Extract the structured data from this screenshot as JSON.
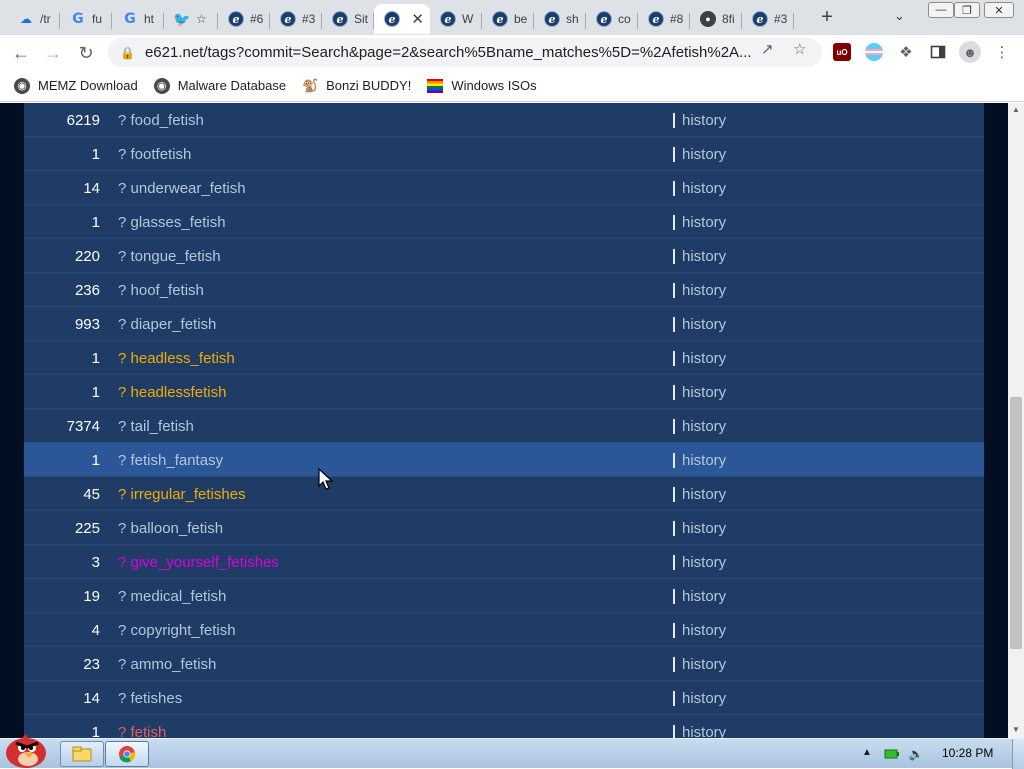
{
  "browser": {
    "tabs": [
      {
        "title": "/tr",
        "icon": "cloud-icon"
      },
      {
        "title": "fu",
        "icon": "google-icon"
      },
      {
        "title": "ht",
        "icon": "google-icon"
      },
      {
        "title": "☆",
        "icon": "twitter-icon"
      },
      {
        "title": "#6",
        "icon": "e621-icon"
      },
      {
        "title": "#3",
        "icon": "e621-icon"
      },
      {
        "title": "Sit",
        "icon": "e621-icon"
      },
      {
        "title": "",
        "icon": "e621-icon",
        "active": true
      },
      {
        "title": "W",
        "icon": "e621-icon"
      },
      {
        "title": "be",
        "icon": "e621-icon"
      },
      {
        "title": "sh",
        "icon": "e621-icon"
      },
      {
        "title": "co",
        "icon": "e621-icon"
      },
      {
        "title": "#8",
        "icon": "e621-icon"
      },
      {
        "title": "8fi",
        "icon": "github-icon"
      },
      {
        "title": "#3",
        "icon": "e621-icon"
      }
    ],
    "new_tab_glyph": "+",
    "url": "e621.net/tags?commit=Search&page=2&search%5Bname_matches%5D=%2Afetish%2A..."
  },
  "bookmarks": [
    {
      "label": "MEMZ Download",
      "icon": "globe-icon"
    },
    {
      "label": "Malware Database",
      "icon": "globe-icon"
    },
    {
      "label": "Bonzi BUDDY!",
      "icon": "bonzi-icon"
    },
    {
      "label": "Windows ISOs",
      "icon": "rainbow-flag-icon"
    }
  ],
  "tag_rows": [
    {
      "count": "6219",
      "name": "? food_fetish",
      "color": "#b4c7d9",
      "history": "history"
    },
    {
      "count": "1",
      "name": "? footfetish",
      "color": "#b4c7d9",
      "history": "history"
    },
    {
      "count": "14",
      "name": "? underwear_fetish",
      "color": "#b4c7d9",
      "history": "history"
    },
    {
      "count": "1",
      "name": "? glasses_fetish",
      "color": "#b4c7d9",
      "history": "history"
    },
    {
      "count": "220",
      "name": "? tongue_fetish",
      "color": "#b4c7d9",
      "history": "history"
    },
    {
      "count": "236",
      "name": "? hoof_fetish",
      "color": "#b4c7d9",
      "history": "history"
    },
    {
      "count": "993",
      "name": "? diaper_fetish",
      "color": "#b4c7d9",
      "history": "history"
    },
    {
      "count": "1",
      "name": "? headless_fetish",
      "color": "#f2ac08",
      "history": "history"
    },
    {
      "count": "1",
      "name": "? headlessfetish",
      "color": "#f2ac08",
      "history": "history"
    },
    {
      "count": "7374",
      "name": "? tail_fetish",
      "color": "#b4c7d9",
      "history": "history"
    },
    {
      "count": "1",
      "name": "? fetish_fantasy",
      "color": "#b4c7d9",
      "history": "history",
      "highlight": true
    },
    {
      "count": "45",
      "name": "? irregular_fetishes",
      "color": "#f2ac08",
      "history": "history"
    },
    {
      "count": "225",
      "name": "? balloon_fetish",
      "color": "#b4c7d9",
      "history": "history"
    },
    {
      "count": "3",
      "name": "? give_yourself_fetishes",
      "color": "#dd00dd",
      "history": "history"
    },
    {
      "count": "19",
      "name": "? medical_fetish",
      "color": "#b4c7d9",
      "history": "history"
    },
    {
      "count": "4",
      "name": "? copyright_fetish",
      "color": "#b4c7d9",
      "history": "history"
    },
    {
      "count": "23",
      "name": "? ammo_fetish",
      "color": "#b4c7d9",
      "history": "history"
    },
    {
      "count": "14",
      "name": "? fetishes",
      "color": "#b4c7d9",
      "history": "history"
    },
    {
      "count": "1",
      "name": "? fetish",
      "color": "#e45f5f",
      "history": "history"
    }
  ],
  "taskbar": {
    "clock": "10:28 PM"
  },
  "colors": {
    "panel": "#1f3c67",
    "page_background": "#020f23",
    "highlight_row": "#2b5799",
    "link": "#b4c7d9"
  }
}
